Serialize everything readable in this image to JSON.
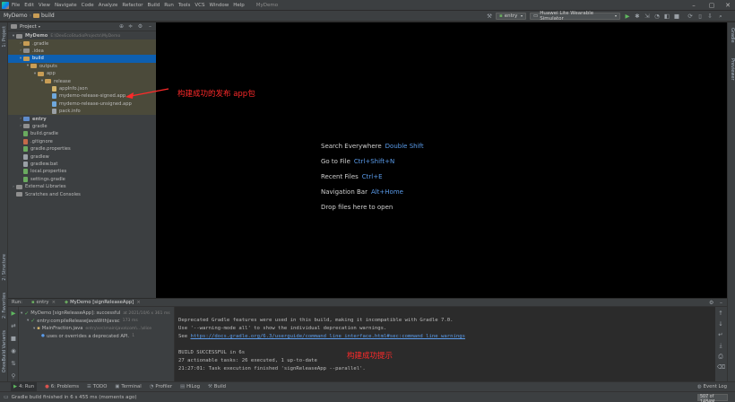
{
  "app": {
    "window_title": "MyDemo",
    "menu": [
      "File",
      "Edit",
      "View",
      "Navigate",
      "Code",
      "Analyze",
      "Refactor",
      "Build",
      "Run",
      "Tools",
      "VCS",
      "Window",
      "Help"
    ]
  },
  "navbar": {
    "project": "MyDemo",
    "folder": "build",
    "run_config": "entry",
    "device": "Huawei Lite Wearable Simulator"
  },
  "left_stripe": {
    "project": "1: Project",
    "structure": "2: Structure",
    "favorites": "2: Favorites",
    "ohosbuild": "OhosBuild Variants"
  },
  "right_stripe": {
    "gradle": "Gradle",
    "previewer": "Previewer"
  },
  "project_panel": {
    "title": "Project",
    "tree": [
      {
        "label": "MyDemo",
        "extra": "E:\\DevEcoStudioProjects\\MyDemo",
        "kind": "fold-plain",
        "indent": 0,
        "chev": "▾",
        "bold": true
      },
      {
        "label": ".gradle",
        "kind": "fold-orange",
        "indent": 1,
        "chev": "›",
        "hl": true
      },
      {
        "label": ".idea",
        "kind": "fold-plain",
        "indent": 1,
        "chev": "›",
        "hl": true
      },
      {
        "label": "build",
        "kind": "fold-orange",
        "indent": 1,
        "chev": "▾",
        "sel": true
      },
      {
        "label": "outputs",
        "kind": "fold-orange",
        "indent": 2,
        "chev": "▾",
        "hl": true
      },
      {
        "label": "app",
        "kind": "fold-orange",
        "indent": 3,
        "chev": "▾",
        "hl": true
      },
      {
        "label": "release",
        "kind": "fold-orange",
        "indent": 4,
        "chev": "▾",
        "hl": true
      },
      {
        "label": "appInfo.json",
        "kind": "file-json",
        "indent": 5,
        "chev": "",
        "hl": true
      },
      {
        "label": "mydemo-release-signed.app",
        "kind": "file-app",
        "indent": 5,
        "chev": "",
        "hl": true
      },
      {
        "label": "mydemo-release-unsigned.app",
        "kind": "file-app",
        "indent": 5,
        "chev": "",
        "hl": true
      },
      {
        "label": "pack.info",
        "kind": "file",
        "indent": 5,
        "chev": "",
        "hl": true
      },
      {
        "label": "entry",
        "kind": "fold-blue",
        "indent": 1,
        "chev": "›",
        "bold": true
      },
      {
        "label": "gradle",
        "kind": "fold-plain",
        "indent": 1,
        "chev": "›"
      },
      {
        "label": "build.gradle",
        "kind": "file-gradle",
        "indent": 1,
        "chev": ""
      },
      {
        "label": ".gitignore",
        "kind": "file-git",
        "indent": 1,
        "chev": ""
      },
      {
        "label": "gradle.properties",
        "kind": "file-gradle",
        "indent": 1,
        "chev": ""
      },
      {
        "label": "gradlew",
        "kind": "file",
        "indent": 1,
        "chev": ""
      },
      {
        "label": "gradlew.bat",
        "kind": "file",
        "indent": 1,
        "chev": ""
      },
      {
        "label": "local.properties",
        "kind": "file-gradle",
        "indent": 1,
        "chev": ""
      },
      {
        "label": "settings.gradle",
        "kind": "file-gradle",
        "indent": 1,
        "chev": ""
      },
      {
        "label": "External Libraries",
        "kind": "fold-plain",
        "indent": 0,
        "chev": "›"
      },
      {
        "label": "Scratches and Consoles",
        "kind": "fold-plain",
        "indent": 0,
        "chev": ""
      }
    ]
  },
  "editor_hints": [
    {
      "text": "Search Everywhere",
      "key": "Double Shift"
    },
    {
      "text": "Go to File",
      "key": "Ctrl+Shift+N"
    },
    {
      "text": "Recent Files",
      "key": "Ctrl+E"
    },
    {
      "text": "Navigation Bar",
      "key": "Alt+Home"
    },
    {
      "text": "Drop files here to open",
      "key": ""
    }
  ],
  "annotations": {
    "signed_app": "构建成功的发布 app包",
    "build_ok": "构建成功提示"
  },
  "run_panel": {
    "tabs": [
      "Run:",
      "entry",
      "MyDemo [signReleaseApp]"
    ],
    "tree": [
      {
        "label": "MyDemo [signReleaseApp]: successful",
        "extra": "at 2021/10/6 x 361 ms"
      },
      {
        "label": "entry:compileReleaseJavaWithJavac",
        "extra": "173 ms"
      },
      {
        "label": "MainFraction.java",
        "extra": "entry\\src\\main\\java\\com\\...\\slice"
      },
      {
        "label": "uses or overrides a deprecated API.",
        "extra": "1"
      }
    ],
    "console": [
      "Deprecated Gradle features were used in this build, making it incompatible with Gradle 7.0.",
      "Use '--warning-mode all' to show the individual deprecation warnings.",
      "See ",
      "",
      "BUILD SUCCESSFUL in 6s",
      "27 actionable tasks: 26 executed, 1 up-to-date",
      "21:27:01: Task execution finished 'signReleaseApp --parallel'."
    ],
    "console_link": "https://docs.gradle.org/6.3/userguide/command_line_interface.html#sec:command_line_warnings"
  },
  "bottom_tabs": [
    "4: Run",
    "6: Problems",
    "TODO",
    "Terminal",
    "Profiler",
    "HiLog",
    "Build"
  ],
  "event_log": "Event Log",
  "status": {
    "message": "Gradle build finished in 6 s 455 ms (moments ago)",
    "memory": "507 of 1484M"
  }
}
